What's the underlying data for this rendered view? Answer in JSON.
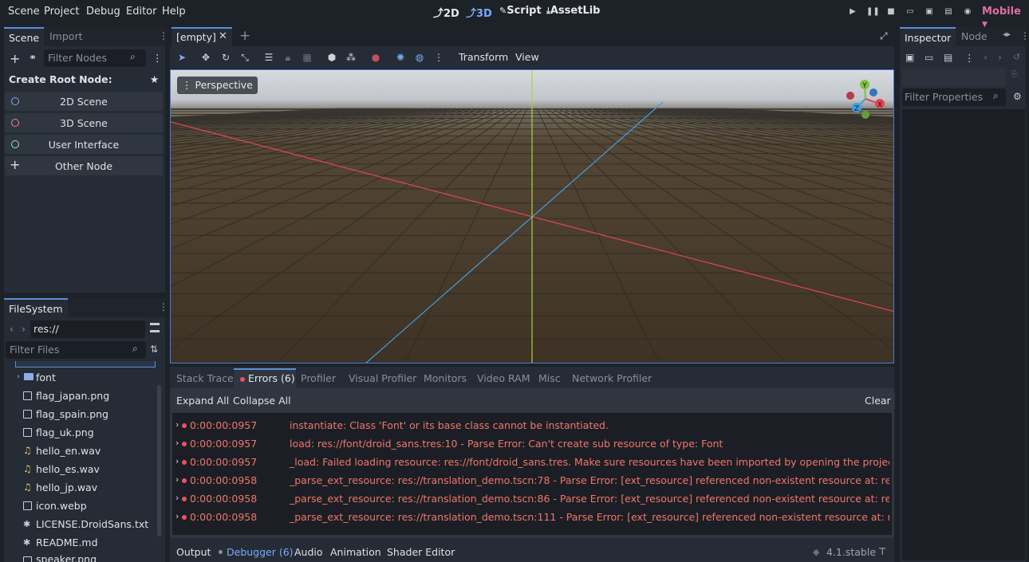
{
  "menu": [
    "Scene",
    "Project",
    "Debug",
    "Editor",
    "Help"
  ],
  "main_tabs": [
    "2D",
    "3D",
    "Script",
    "AssetLib"
  ],
  "renderer": "Mobile",
  "scene_dock": {
    "tabs": [
      "Scene",
      "Import"
    ],
    "filter_placeholder": "Filter Nodes",
    "create_root_label": "Create Root Node:",
    "root_buttons": [
      "2D Scene",
      "3D Scene",
      "User Interface",
      "Other Node"
    ]
  },
  "filesystem": {
    "tab": "FileSystem",
    "path": "res://",
    "filter_placeholder": "Filter Files",
    "items": [
      "font",
      "flag_japan.png",
      "flag_spain.png",
      "flag_uk.png",
      "hello_en.wav",
      "hello_es.wav",
      "hello_jp.wav",
      "icon.webp",
      "LICENSE.DroidSans.txt",
      "README.md",
      "speaker.png"
    ]
  },
  "scene_tab": "[empty]",
  "viewport": {
    "transform_label": "Transform",
    "view_label": "View",
    "perspective_label": "Perspective",
    "gizmo": {
      "x": "X",
      "y": "Y",
      "z": "Z"
    }
  },
  "bottom_panel": {
    "tabs": [
      "Stack Trace",
      "Errors (6)",
      "Profiler",
      "Visual Profiler",
      "Monitors",
      "Video RAM",
      "Misc",
      "Network Profiler"
    ],
    "expand_all": "Expand All",
    "collapse_all": "Collapse All",
    "clear": "Clear",
    "errors": [
      {
        "time": "0:00:00:0957",
        "msg": "instantiate: Class 'Font' or its base class cannot be instantiated."
      },
      {
        "time": "0:00:00:0957",
        "msg": "load: res://font/droid_sans.tres:10 - Parse Error: Can't create sub resource of type: Font"
      },
      {
        "time": "0:00:00:0957",
        "msg": "_load: Failed loading resource: res://font/droid_sans.tres. Make sure resources have been imported by opening the project in the edit"
      },
      {
        "time": "0:00:00:0958",
        "msg": "_parse_ext_resource: res://translation_demo.tscn:78 - Parse Error: [ext_resource] referenced non-existent resource at: res://font/droid"
      },
      {
        "time": "0:00:00:0958",
        "msg": "_parse_ext_resource: res://translation_demo.tscn:86 - Parse Error: [ext_resource] referenced non-existent resource at: res://font/droid"
      },
      {
        "time": "0:00:00:0958",
        "msg": "_parse_ext_resource: res://translation_demo.tscn:111 - Parse Error: [ext_resource] referenced non-existent resource at: res://font/droi"
      }
    ]
  },
  "bottom_bar": {
    "tabs": [
      "Output",
      "Debugger (6)",
      "Audio",
      "Animation",
      "Shader Editor"
    ],
    "version": "4.1.stable"
  },
  "inspector": {
    "tabs": [
      "Inspector",
      "Node"
    ],
    "filter_placeholder": "Filter Properties"
  }
}
